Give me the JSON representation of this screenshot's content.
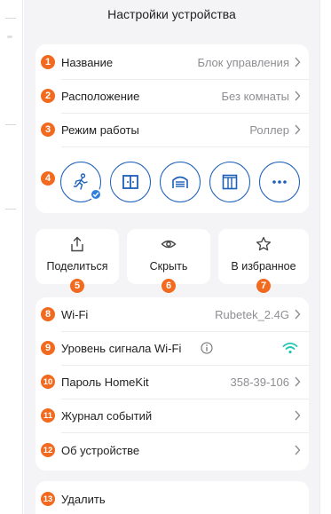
{
  "header": {
    "title": "Настройки устройства"
  },
  "settings_top": [
    {
      "num": "1",
      "label": "Название",
      "value": "Блок управления"
    },
    {
      "num": "2",
      "label": "Расположение",
      "value": "Без комнаты"
    },
    {
      "num": "3",
      "label": "Режим работы",
      "value": "Роллер"
    }
  ],
  "modes": {
    "num": "4",
    "icons": [
      "running-person-icon",
      "window-icon",
      "garage-door-icon",
      "curtain-icon",
      "more-dots-icon"
    ],
    "selected_index": 0
  },
  "actions": [
    {
      "num": "5",
      "label": "Поделиться",
      "icon": "share-icon"
    },
    {
      "num": "6",
      "label": "Скрыть",
      "icon": "eye-icon"
    },
    {
      "num": "7",
      "label": "В избранное",
      "icon": "star-icon"
    }
  ],
  "settings_bottom": [
    {
      "num": "8",
      "label": "Wi-Fi",
      "value": "Rubetek_2.4G"
    },
    {
      "num": "9",
      "label": "Уровень сигнала Wi-Fi",
      "value": ""
    },
    {
      "num": "10",
      "label": "Пароль HomeKit",
      "value": "358-39-106"
    },
    {
      "num": "11",
      "label": "Журнал событий",
      "value": ""
    },
    {
      "num": "12",
      "label": "Об устройстве",
      "value": ""
    }
  ],
  "delete": {
    "num": "13",
    "label": "Удалить"
  },
  "colors": {
    "accent_orange": "#f26a1f",
    "icon_blue": "#1c5fb8",
    "badge_blue": "#2f7fdd",
    "wifi_green": "#1fc6b4",
    "value_gray": "#8e8e93",
    "background": "#f4f4f6"
  }
}
